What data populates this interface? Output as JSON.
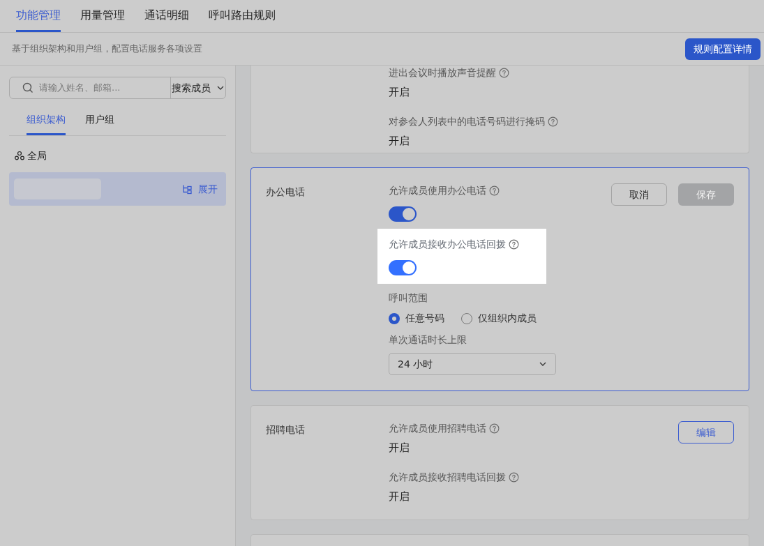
{
  "tabs": [
    {
      "label": "功能管理",
      "selected": true
    },
    {
      "label": "用量管理",
      "selected": false
    },
    {
      "label": "通话明细",
      "selected": false
    },
    {
      "label": "呼叫路由规则",
      "selected": false
    }
  ],
  "description": "基于组织架构和用户组，配置电话服务各项设置",
  "detail_button": "规则配置详情",
  "sidebar": {
    "search": {
      "placeholder": "请输入姓名、邮箱...",
      "scope": "搜索成员"
    },
    "tabs": [
      {
        "label": "组织架构",
        "selected": true
      },
      {
        "label": "用户组",
        "selected": false
      }
    ],
    "tree": [
      {
        "kind": "root",
        "label": "全局",
        "selected": false
      },
      {
        "kind": "node",
        "selected": true,
        "action": "展开"
      }
    ]
  },
  "sections": [
    {
      "kind": "readonly",
      "settings": [
        {
          "kind": "value",
          "label": "进出会议时播放声音提醒",
          "help": true,
          "value": "开启"
        },
        {
          "kind": "value",
          "label": "对参会人列表中的电话号码进行掩码",
          "help": true,
          "value": "开启"
        }
      ]
    },
    {
      "kind": "editing",
      "title": "办公电话",
      "buttons": [
        {
          "label": "取消",
          "kind": "secondary"
        },
        {
          "label": "保存",
          "kind": "primary",
          "disabled": true
        }
      ],
      "settings": [
        {
          "kind": "toggle",
          "label": "允许成员使用办公电话",
          "help": true,
          "on": true,
          "highlighted": false
        },
        {
          "kind": "toggle",
          "label": "允许成员接收办公电话回拨",
          "help": true,
          "on": true,
          "highlighted": true
        },
        {
          "kind": "radio",
          "label": "呼叫范围",
          "help": false,
          "options": [
            {
              "label": "任意号码",
              "selected": true
            },
            {
              "label": "仅组织内成员",
              "selected": false
            }
          ]
        },
        {
          "kind": "select",
          "label": "单次通话时长上限",
          "help": false,
          "value": "24 小时"
        }
      ]
    },
    {
      "kind": "readonly",
      "title": "招聘电话",
      "buttons": [
        {
          "label": "编辑",
          "kind": "outline"
        }
      ],
      "settings": [
        {
          "kind": "value",
          "label": "允许成员使用招聘电话",
          "help": true,
          "value": "开启"
        },
        {
          "kind": "value",
          "label": "允许成员接收招聘电话回拨",
          "help": true,
          "value": "开启"
        }
      ]
    },
    {
      "kind": "blank"
    }
  ]
}
